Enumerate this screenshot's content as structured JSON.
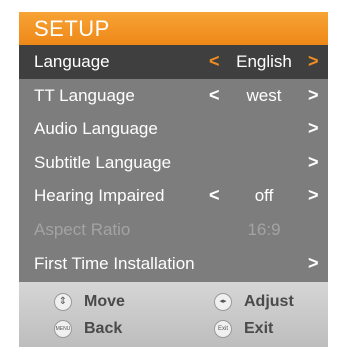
{
  "title": "SETUP",
  "rows": [
    {
      "label": "Language",
      "left": "<",
      "value": "English",
      "right": ">"
    },
    {
      "label": "TT Language",
      "left": "<",
      "value": "west",
      "right": ">"
    },
    {
      "label": "Audio Language",
      "left": "",
      "value": "",
      "right": ">"
    },
    {
      "label": "Subtitle Language",
      "left": "",
      "value": "",
      "right": ">"
    },
    {
      "label": "Hearing Impaired",
      "left": "<",
      "value": "off",
      "right": ">"
    },
    {
      "label": "Aspect Ratio",
      "left": "",
      "value": "16:9",
      "right": ""
    },
    {
      "label": "First Time Installation",
      "left": "",
      "value": "",
      "right": ">"
    }
  ],
  "footer": {
    "move": {
      "icon": "⇕",
      "label": "Move"
    },
    "adjust": {
      "icon": "◂▸",
      "label": "Adjust"
    },
    "back": {
      "icon": "MENU",
      "label": "Back"
    },
    "exit": {
      "icon": "Exit",
      "label": "Exit"
    }
  },
  "colors": {
    "accent": "#f28d1f",
    "panel": "#7d7d7d",
    "selected_row": "#3f3f3f",
    "disabled_text": "#a3a3a3",
    "footer": "#c8c8c8"
  }
}
